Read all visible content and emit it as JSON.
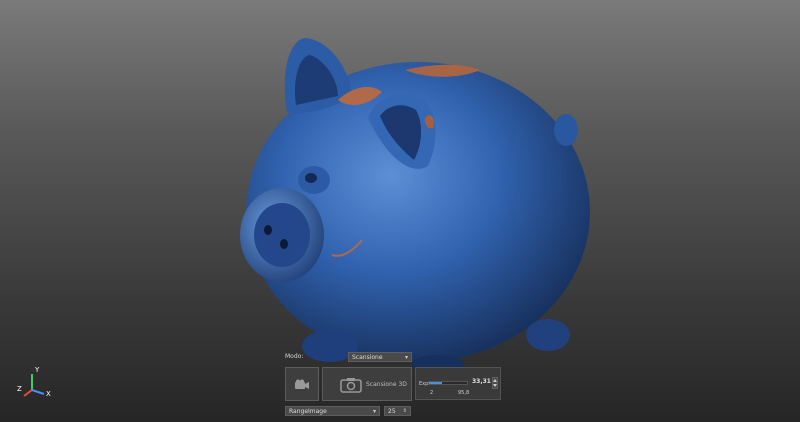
{
  "controls": {
    "mode_label": "Modo:",
    "mode_value": "Scansione",
    "scan_button_label": "Scansione 3D",
    "exposure_label": "Exp",
    "exposure_value": "33,31",
    "exposure_min": "2",
    "exposure_max": "95,8",
    "exposure_level": 0.33,
    "range_select_value": "RangeImage",
    "range_number": "25"
  },
  "axes": {
    "x": "X",
    "y": "Y",
    "z": "Z"
  },
  "icons": {
    "video": "video-camera-icon",
    "camera": "camera-icon",
    "mode_arrow": "chevron-down-icon",
    "range_arrow": "chevron-down-icon",
    "stepper": "stepper-arrows-icon"
  },
  "colors": {
    "model_blue": "#2f5fa8",
    "accent_blue": "#5aa0e0",
    "exposure_fill": "#4a8fd8"
  }
}
